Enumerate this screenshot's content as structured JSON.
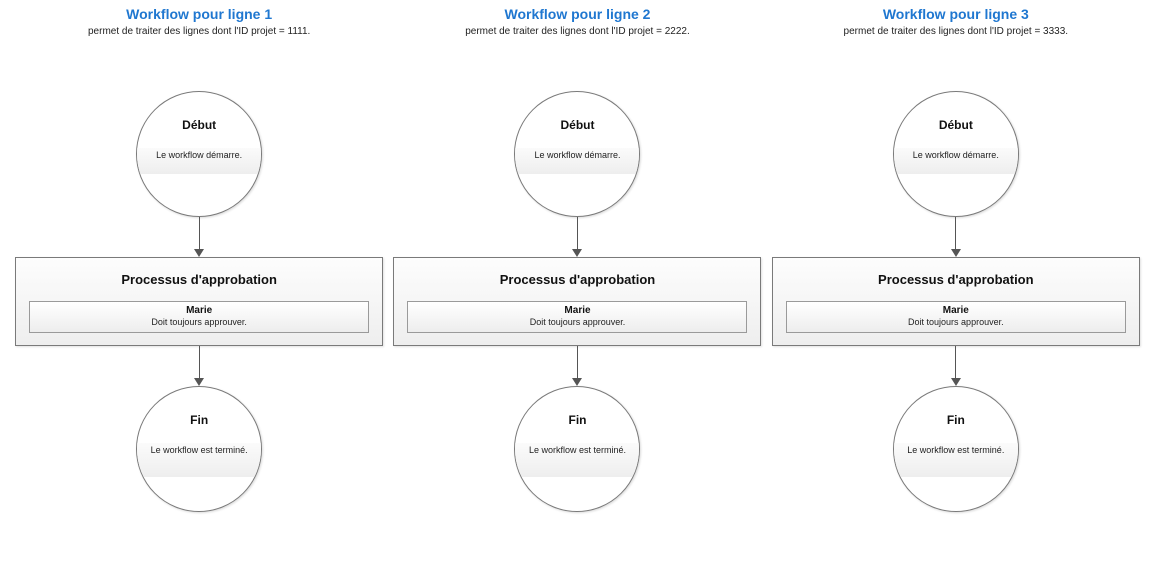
{
  "columns": [
    {
      "title": "Workflow pour ligne 1",
      "subtitle": "permet de traiter des lignes dont l'ID projet = 1111.",
      "start_title": "Début",
      "start_desc": "Le workflow démarre.",
      "process_title": "Processus d'approbation",
      "approver_name": "Marie",
      "approver_desc": "Doit toujours approuver.",
      "end_title": "Fin",
      "end_desc": "Le workflow est terminé."
    },
    {
      "title": "Workflow pour ligne 2",
      "subtitle": "permet de traiter des lignes dont l'ID projet = 2222.",
      "start_title": "Début",
      "start_desc": "Le workflow démarre.",
      "process_title": "Processus d'approbation",
      "approver_name": "Marie",
      "approver_desc": "Doit toujours approuver.",
      "end_title": "Fin",
      "end_desc": "Le workflow est terminé."
    },
    {
      "title": "Workflow pour ligne 3",
      "subtitle": "permet de traiter des lignes dont l'ID projet = 3333.",
      "start_title": "Début",
      "start_desc": "Le workflow démarre.",
      "process_title": "Processus d'approbation",
      "approver_name": "Marie",
      "approver_desc": "Doit toujours approuver.",
      "end_title": "Fin",
      "end_desc": "Le workflow est terminé."
    }
  ]
}
